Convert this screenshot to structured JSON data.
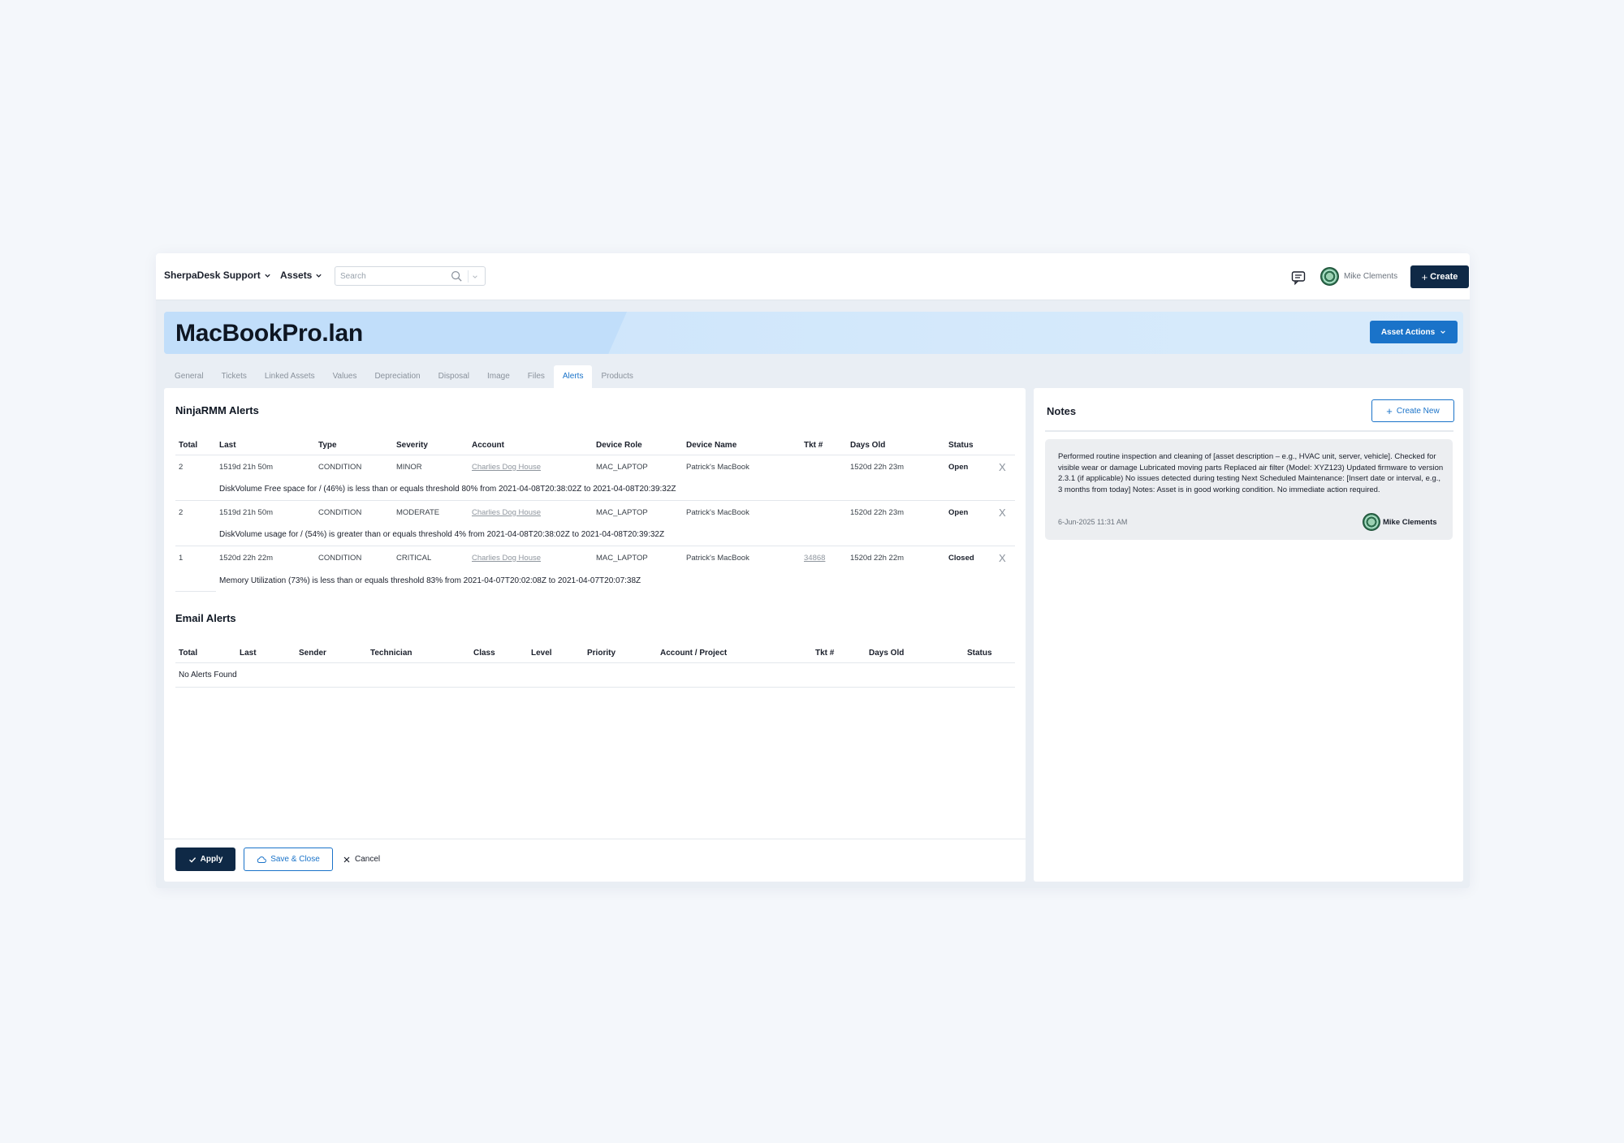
{
  "topbar": {
    "org_menu": "SherpaDesk Support",
    "module_menu": "Assets",
    "search_placeholder": "Search",
    "user_name": "Mike Clements",
    "create_label": "Create"
  },
  "asset": {
    "title": "MacBookPro.lan",
    "actions_label": "Asset Actions"
  },
  "tabs": [
    {
      "label": "General",
      "active": false
    },
    {
      "label": "Tickets",
      "active": false
    },
    {
      "label": "Linked Assets",
      "active": false
    },
    {
      "label": "Values",
      "active": false
    },
    {
      "label": "Depreciation",
      "active": false
    },
    {
      "label": "Disposal",
      "active": false
    },
    {
      "label": "Image",
      "active": false
    },
    {
      "label": "Files",
      "active": false
    },
    {
      "label": "Alerts",
      "active": true
    },
    {
      "label": "Products",
      "active": false
    }
  ],
  "ninja": {
    "title": "NinjaRMM Alerts",
    "columns": [
      "Total",
      "Last",
      "Type",
      "Severity",
      "Account",
      "Device Role",
      "Device Name",
      "Tkt #",
      "Days Old",
      "Status"
    ],
    "rows": [
      {
        "total": "2",
        "last": "1519d 21h 50m",
        "type": "CONDITION",
        "severity": "MINOR",
        "account": "Charlies Dog House",
        "device_role": "MAC_LAPTOP",
        "device_name": "Patrick's MacBook",
        "tkt": "",
        "days_old": "1520d 22h 23m",
        "status": "Open",
        "dismiss": "X",
        "message": "DiskVolume Free space for / (46%) is less than or equals threshold 80% from 2021-04-08T20:38:02Z to 2021-04-08T20:39:32Z"
      },
      {
        "total": "2",
        "last": "1519d 21h 50m",
        "type": "CONDITION",
        "severity": "MODERATE",
        "account": "Charlies Dog House",
        "device_role": "MAC_LAPTOP",
        "device_name": "Patrick's MacBook",
        "tkt": "",
        "days_old": "1520d 22h 23m",
        "status": "Open",
        "dismiss": "X",
        "message": "DiskVolume usage for / (54%) is greater than or equals threshold 4% from 2021-04-08T20:38:02Z to 2021-04-08T20:39:32Z"
      },
      {
        "total": "1",
        "last": "1520d 22h 22m",
        "type": "CONDITION",
        "severity": "CRITICAL",
        "account": "Charlies Dog House",
        "device_role": "MAC_LAPTOP",
        "device_name": "Patrick's MacBook",
        "tkt": "34868",
        "days_old": "1520d 22h 22m",
        "status": "Closed",
        "dismiss": "X",
        "message": "Memory Utilization (73%) is less than or equals threshold 83% from 2021-04-07T20:02:08Z to 2021-04-07T20:07:38Z"
      }
    ]
  },
  "email": {
    "title": "Email Alerts",
    "columns": [
      "Total",
      "Last",
      "Sender",
      "Technician",
      "Class",
      "Level",
      "Priority",
      "Account / Project",
      "Tkt #",
      "Days Old",
      "Status"
    ],
    "empty": "No Alerts Found"
  },
  "footer": {
    "apply_label": "Apply",
    "save_close_label": "Save & Close",
    "cancel_label": "Cancel"
  },
  "notes": {
    "title": "Notes",
    "create_new_label": "Create New",
    "items": [
      {
        "text": "Performed routine inspection and cleaning of [asset description – e.g., HVAC unit, server, vehicle]. Checked for visible wear or damage Lubricated moving parts Replaced air filter (Model: XYZ123) Updated firmware to version 2.3.1 (if applicable) No issues detected during testing Next Scheduled Maintenance: [Insert date or interval, e.g., 3 months from today] Notes: Asset is in good working condition. No immediate action required.",
        "date": "6-Jun-2025 11:31 AM",
        "author": "Mike Clements"
      }
    ]
  },
  "colors": {
    "navy": "#0f2946",
    "accent_blue": "#1a73c9",
    "banner": "#c9e3fb"
  },
  "icons": [
    "chevron-down-icon",
    "search-icon",
    "chat-icon",
    "plus-icon",
    "check-icon",
    "cloud-icon",
    "close-icon"
  ]
}
